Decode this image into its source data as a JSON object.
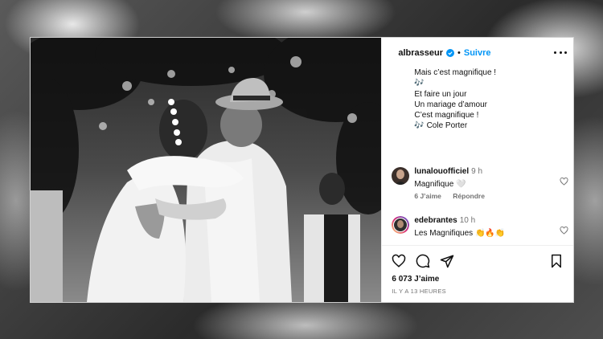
{
  "post": {
    "username": "albrasseur",
    "follow_label": "Suivre",
    "separator": "•",
    "caption_lines": [
      "Mais c’est magnifique !",
      "🎶",
      "Et faire un jour",
      "Un mariage d’amour",
      "C’est magnifique !",
      "",
      "🎶 Cole Porter"
    ],
    "likes": "6 073 J’aime",
    "time_ago": "IL Y A 13 HEURES"
  },
  "comments": [
    {
      "user": "lunalouofficiel",
      "time": "9 h",
      "text": "Magnifique 🤍",
      "likes_label": "6 J’aime",
      "reply_label": "Répondre"
    },
    {
      "user": "edebrantes",
      "time": "10 h",
      "text": "Les Magnifiques 👏🔥👏"
    }
  ],
  "icons": [
    "verified-badge-icon",
    "more-options-icon",
    "heart-icon",
    "comment-icon",
    "share-icon",
    "bookmark-icon"
  ],
  "colors": {
    "accent": "#0095f6",
    "text": "#111111",
    "muted": "#737373"
  }
}
